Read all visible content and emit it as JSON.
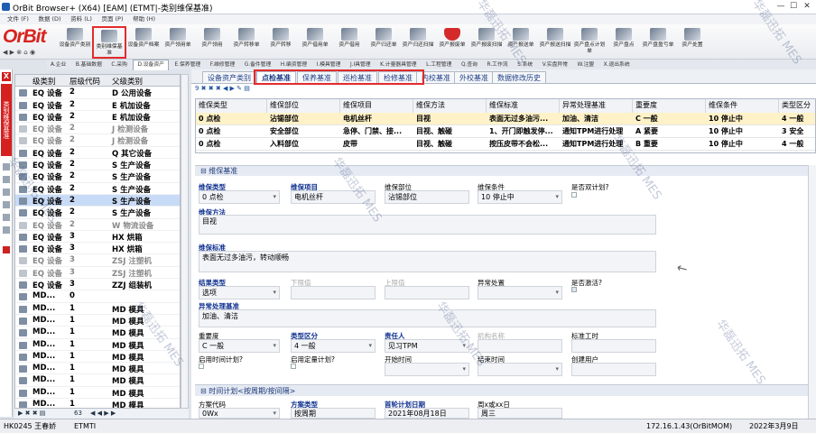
{
  "window": {
    "title": "OrBit Browser+ (X64) [EAM] (ETMT|-类别维保基准)"
  },
  "menu": [
    "文件 (F)",
    "数据 (D)",
    "资料 (L)",
    "页面 (P)",
    "帮助 (H)"
  ],
  "logo": "OrBit",
  "toolbar": [
    "设备资产类别",
    "类别维保基准",
    "设备资产档案",
    "资产领用单",
    "资产领用",
    "资产转移单",
    "资产转移",
    "资产借用单",
    "资产借用",
    "资产归还单",
    "资产归还扫描",
    "资产报废单",
    "资产报废扫描",
    "资产报送单",
    "资产报送扫描",
    "资产报还单",
    "资产报还扫描",
    "资产盘点计划单",
    "资产盘点",
    "资产盘盈亏单",
    "资产处置"
  ],
  "module_tabs": [
    "A.企业",
    "B.基础数据",
    "C.采购",
    "D.设备资产",
    "E.保养管理",
    "F.维修管理",
    "G.备件管理",
    "H.编资管理",
    "I.模具管理",
    "J.I具管理",
    "K.计量器具管理",
    "L.工程管理",
    "Q.查询",
    "R.工作流",
    "S.系统",
    "V.实盘异常",
    "W.注盟",
    "X.退出系统"
  ],
  "left_strip": {
    "close": "X",
    "vertical_label": "类别维保基准"
  },
  "left_table": {
    "headers": [
      "级类别",
      "层级代码",
      "父级类别"
    ],
    "rows": [
      [
        "EQ 设备",
        "2",
        "D 公用设备",
        ""
      ],
      [
        "EQ 设备",
        "2",
        "E 机加设备",
        ""
      ],
      [
        "EQ 设备",
        "2",
        "E 机加设备",
        ""
      ],
      [
        "EQ 设备",
        "2",
        "J 检测设备",
        "gray"
      ],
      [
        "EQ 设备",
        "2",
        "J 检测设备",
        "gray"
      ],
      [
        "EQ 设备",
        "2",
        "Q 其它设备",
        ""
      ],
      [
        "EQ 设备",
        "2",
        "S 生产设备",
        ""
      ],
      [
        "EQ 设备",
        "2",
        "S 生产设备",
        ""
      ],
      [
        "EQ 设备",
        "2",
        "S 生产设备",
        ""
      ],
      [
        "EQ 设备",
        "2",
        "S 生产设备",
        "sel"
      ],
      [
        "EQ 设备",
        "2",
        "S 生产设备",
        ""
      ],
      [
        "EQ 设备",
        "2",
        "W 物流设备",
        "gray"
      ],
      [
        "EQ 设备",
        "3",
        "HX 烘箱",
        ""
      ],
      [
        "EQ 设备",
        "3",
        "HX 烘箱",
        ""
      ],
      [
        "EQ 设备",
        "3",
        "ZSJ 注塑机",
        "gray"
      ],
      [
        "EQ 设备",
        "3",
        "ZSJ 注塑机",
        "gray"
      ],
      [
        "EQ 设备",
        "3",
        "ZZJ 组装机",
        ""
      ],
      [
        "MD...",
        "0",
        "",
        ""
      ],
      [
        "MD...",
        "1",
        "MD 模具",
        ""
      ],
      [
        "MD...",
        "1",
        "MD 模具",
        ""
      ],
      [
        "MD...",
        "1",
        "MD 模具",
        ""
      ],
      [
        "MD...",
        "1",
        "MD 模具",
        ""
      ],
      [
        "MD...",
        "1",
        "MD 模具",
        ""
      ],
      [
        "MD...",
        "1",
        "MD 模具",
        ""
      ],
      [
        "MD...",
        "1",
        "MD 模具",
        ""
      ],
      [
        "MD...",
        "1",
        "MD 模具",
        ""
      ],
      [
        "MD...",
        "1",
        "MD 模具",
        ""
      ]
    ],
    "pager": "63"
  },
  "subtabs": [
    "设备资产类别",
    "点检基准",
    "保养基准",
    "巡检基准",
    "检修基准",
    "内校基准",
    "外校基准",
    "数据修改历史"
  ],
  "grid": {
    "headers": [
      "维保类型",
      "维保部位",
      "维保项目",
      "维保方法",
      "维保标准",
      "异常处理基准",
      "重要度",
      "维保条件",
      "类型区分"
    ],
    "rows": [
      [
        "0 点检",
        "沾锡部位",
        "电机丝杆",
        "目视",
        "表面无过多油污...",
        "加油、清洁",
        "C 一般",
        "10 停止中",
        "4 一般"
      ],
      [
        "0 点检",
        "安全部位",
        "急停、门禁、接...",
        "目视、触碰",
        "1、开门即触发停...",
        "通知TPM进行处理",
        "A 紧要",
        "10 停止中",
        "3 安全"
      ],
      [
        "0 点检",
        "入料部位",
        "皮带",
        "目视、触碰",
        "按压皮带不会松...",
        "通知TPM进行处理",
        "B 重要",
        "10 停止中",
        "4 一般"
      ]
    ]
  },
  "section1": "维保基准",
  "form": {
    "type_label": "维保类型",
    "type_value": "0 点检",
    "item_label": "维保项目",
    "item_value": "电机丝杆",
    "part_label": "维保部位",
    "part_value": "沾锡部位",
    "cond_label": "维保条件",
    "cond_value": "10 停止中",
    "double_label": "是否双计划?",
    "method_label": "维保方法",
    "method_value": "目视",
    "standard_label": "维保标准",
    "standard_value": "表面无过多油污，转动顺畅",
    "result_label": "结果类型",
    "result_value": "选项",
    "lower_label": "下限值",
    "upper_label": "上限值",
    "abnormal_label": "异常处置",
    "active_label": "是否激活?",
    "handling_label": "异常处理基准",
    "handling_value": "加油、清洁",
    "importance_label": "重要度",
    "importance_value": "C 一般",
    "typediff_label": "类型区分",
    "typediff_value": "4 一般",
    "owner_label": "责任人",
    "owner_value": "见习TPM",
    "org_label": "机构名称",
    "std_hours_label": "标准工时",
    "time_plan_label": "启用时间计划?",
    "qty_plan_label": "启用定量计划?",
    "start_label": "开始时间",
    "end_label": "结束时间",
    "creator_label": "创建用户"
  },
  "section2": "时间计划<按周期/按间隔>",
  "plan": {
    "code_label": "方案代码",
    "code_value": "0Wx",
    "type_label": "方案类型",
    "type_value": "按周期",
    "first_label": "首轮计划日期",
    "first_value": "2021年08月18日",
    "week_label": "周x或xx日",
    "week_value": "周三"
  },
  "icon_row": "9 ✖ ✖ ✖ ◀ ▶ ✎ ▤",
  "status": {
    "user": "HK0245 王春娇",
    "app": "ETMTI",
    "server": "172.16.1.43(OrBitMOM)",
    "date": "2022年3月9日"
  },
  "watermark": "华磊迅拓 MES"
}
